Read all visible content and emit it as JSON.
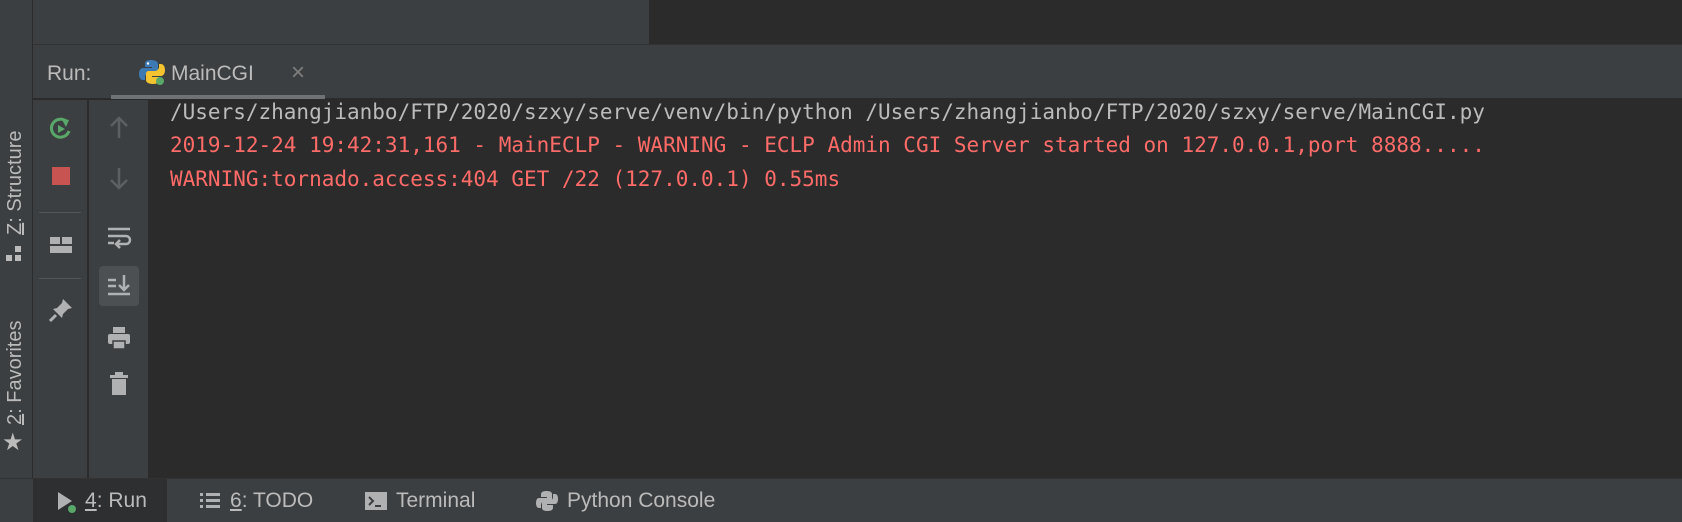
{
  "run_header": {
    "label": "Run:",
    "tab_label": "MainCGI",
    "close_glyph": "×"
  },
  "side_tabs": {
    "structure": {
      "key": "Z",
      "rest": ": Structure"
    },
    "favorites": {
      "key": "2",
      "rest": ": Favorites",
      "star": "★"
    }
  },
  "console": {
    "lines": [
      "/Users/zhangjianbo/FTP/2020/szxy/serve/venv/bin/python /Users/zhangjianbo/FTP/2020/szxy/serve/MainCGI.py",
      "2019-12-24 19:42:31,161 - MainECLP - WARNING - ECLP Admin CGI Server started on 127.0.0.1,port 8888.....",
      "WARNING:tornado.access:404 GET /22 (127.0.0.1) 0.55ms"
    ]
  },
  "bottom_tabs": {
    "run": {
      "key": "4",
      "rest": ": Run"
    },
    "todo": {
      "key": "6",
      "rest": ": TODO"
    },
    "terminal": {
      "label": "Terminal"
    },
    "python_console": {
      "label": "Python Console"
    }
  },
  "colors": {
    "panel": "#3c3f41",
    "console_bg": "#2b2b2b",
    "text": "#bbbbbb",
    "error": "#ff6b68",
    "rerun_green": "#59a869",
    "stop_red": "#c75450"
  },
  "icons": {
    "rerun": "rerun-icon",
    "stop": "stop-icon",
    "layout": "restore-layout-icon",
    "pin": "pin-icon",
    "up": "up-arrow-icon",
    "down": "down-arrow-icon",
    "wrap": "soft-wrap-icon",
    "scroll": "scroll-to-end-icon",
    "print": "print-icon",
    "trash": "trash-icon"
  }
}
